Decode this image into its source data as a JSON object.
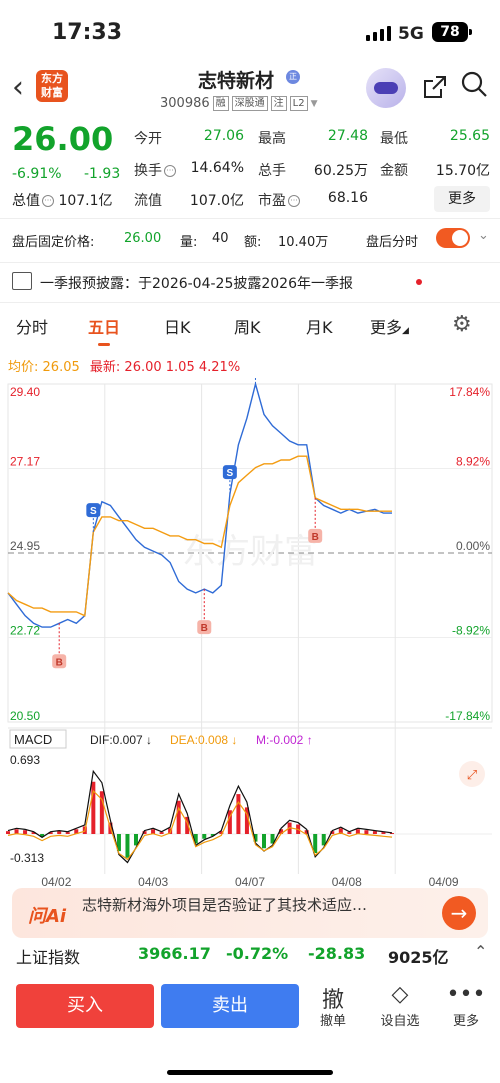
{
  "status": {
    "time": "17:33",
    "network": "5G",
    "battery": "78"
  },
  "header": {
    "logo": "东方财富",
    "stock_name": "志特新材",
    "badge": "正",
    "code": "300986",
    "tags": [
      "融",
      "深股通",
      "注",
      "L2"
    ]
  },
  "quote": {
    "price": "26.00",
    "change_pct": "-6.91%",
    "change": "-1.93",
    "fields": [
      {
        "label": "今开",
        "value": "27.06",
        "color": "#12a32b"
      },
      {
        "label": "最高",
        "value": "27.48",
        "color": "#12a32b"
      },
      {
        "label": "最低",
        "value": "25.65",
        "color": "#12a32b"
      },
      {
        "label": "换手",
        "value": "14.64%",
        "color": "#222"
      },
      {
        "label": "总手",
        "value": "60.25万",
        "color": "#222"
      },
      {
        "label": "金额",
        "value": "15.70亿",
        "color": "#222"
      },
      {
        "label": "流值",
        "value": "107.0亿",
        "color": "#222"
      },
      {
        "label": "市盈",
        "value": "68.16",
        "color": "#222"
      }
    ],
    "mcap_label": "总值",
    "mcap_value": "107.1亿",
    "more": "更多"
  },
  "after_hours": {
    "label": "盘后固定价格:",
    "price": "26.00",
    "vol_label": "量:",
    "vol": "40",
    "amt_label": "额:",
    "amt": "10.40万",
    "toggle_label": "盘后分时"
  },
  "notice": {
    "text": "一季报预披露：于2026-04-25披露2026年一季报"
  },
  "tabs": [
    "分时",
    "五日",
    "日K",
    "周K",
    "月K",
    "更多"
  ],
  "active_tab": "五日",
  "avg_bar": {
    "avg_label": "均价:",
    "avg": "26.05",
    "latest_label": "最新:",
    "latest": "26.00",
    "chg": "1.05",
    "pct": "4.21%"
  },
  "chart_data": {
    "type": "line",
    "y_left_ticks": [
      "29.40",
      "27.17",
      "24.95",
      "22.72",
      "20.50"
    ],
    "y_right_ticks": [
      "17.84%",
      "8.92%",
      "0.00%",
      "-8.92%",
      "-17.84%"
    ],
    "ylim": [
      20.5,
      29.4
    ],
    "prev_close": 24.95,
    "days": [
      "04/02",
      "04/03",
      "04/07",
      "04/08",
      "04/09"
    ],
    "series": [
      {
        "values": [
          23.9,
          23.6,
          23.3,
          23.1,
          23.0,
          23.0,
          23.1,
          23.2,
          23.1,
          23.3,
          25.5,
          26.3,
          26.2,
          25.9,
          25.6,
          25.3,
          25.1,
          25.0,
          24.9,
          24.7,
          24.2,
          24.0,
          23.9,
          24.0,
          23.9,
          24.1,
          26.5,
          27.8,
          28.5,
          29.4,
          28.6,
          28.3,
          28.1,
          27.9,
          27.8,
          27.8,
          26.4,
          26.2,
          26.1,
          26.0,
          26.1,
          26.0,
          26.05,
          26.1,
          26.0,
          26.0
        ]
      },
      {
        "values": [
          23.9,
          23.7,
          23.6,
          23.5,
          23.5,
          23.4,
          23.4,
          23.4,
          23.4,
          23.3,
          25.5,
          25.9,
          25.9,
          25.8,
          25.8,
          25.7,
          25.6,
          25.6,
          25.5,
          25.4,
          25.4,
          25.3,
          25.3,
          25.2,
          25.2,
          25.1,
          26.2,
          26.8,
          27.0,
          27.2,
          27.3,
          27.3,
          27.4,
          27.4,
          27.5,
          27.5,
          26.4,
          26.3,
          26.2,
          26.1,
          26.1,
          26.1,
          26.05,
          26.05,
          26.05,
          26.05
        ]
      }
    ],
    "markers": [
      {
        "label": "B"
      },
      {
        "label": "S"
      },
      {
        "label": "B"
      },
      {
        "label": "S"
      },
      {
        "label": "S"
      },
      {
        "label": "B"
      }
    ],
    "macd": {
      "title": "MACD",
      "dif": "DIF:0.007 ↓",
      "dea": "DEA:0.008 ↓",
      "m": "M:-0.002 ↑",
      "top": "0.693",
      "bottom": "-0.313",
      "hist": [
        0.03,
        0.05,
        0.04,
        0.02,
        -0.03,
        0.02,
        0.03,
        0.02,
        0.05,
        0.08,
        0.55,
        0.45,
        0.12,
        -0.18,
        -0.25,
        -0.12,
        0.03,
        0.05,
        0.02,
        0.06,
        0.35,
        0.18,
        -0.1,
        -0.05,
        -0.02,
        0.03,
        0.25,
        0.42,
        0.28,
        -0.08,
        -0.15,
        -0.1,
        0.05,
        0.12,
        0.1,
        0.04,
        -0.2,
        -0.12,
        0.03,
        0.06,
        0.02,
        0.05,
        0.04,
        0.03,
        0.02,
        0.01
      ]
    },
    "watermark": "东方财富"
  },
  "ai": {
    "label": "问Ai",
    "text": "志特新材海外项目是否验证了其技术适应…"
  },
  "index": {
    "name": "上证指数",
    "value": "3966.17",
    "pct": "-0.72%",
    "chg": "-28.83",
    "amount": "9025亿"
  },
  "bottom": {
    "buy": "买入",
    "sell": "卖出",
    "tools": [
      {
        "icon": "撤",
        "label": "撤单"
      },
      {
        "icon": "◇",
        "label": "设自选"
      },
      {
        "icon": "•••",
        "label": "更多"
      }
    ]
  }
}
